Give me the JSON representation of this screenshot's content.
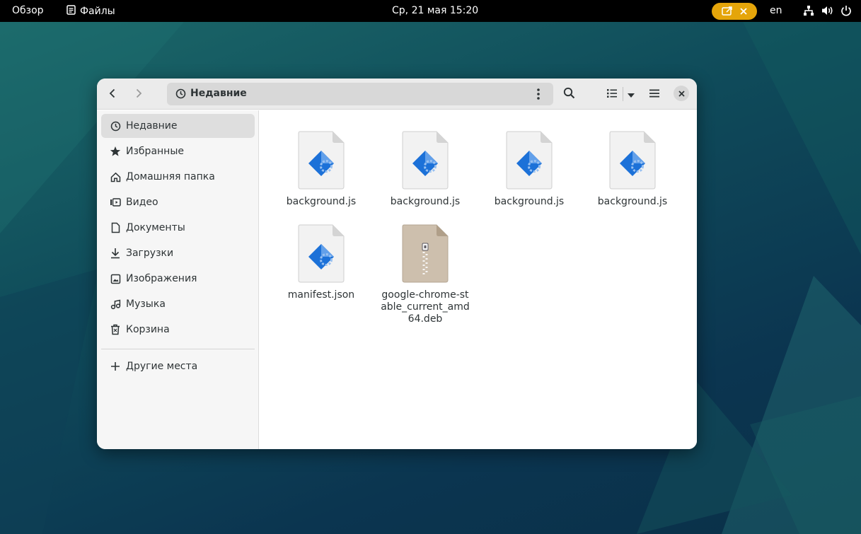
{
  "topbar": {
    "activities": "Обзор",
    "app_name": "Файлы",
    "clock": "Ср, 21 мая  15:20",
    "language": "en",
    "icons": [
      "files-app-icon",
      "screencast-icon",
      "stop-icon",
      "network-icon",
      "volume-icon",
      "power-icon"
    ],
    "screencast_color": "#e5a50a"
  },
  "window": {
    "location": "Недавние",
    "icons": [
      "back-icon",
      "forward-icon",
      "recent-icon",
      "path-menu-icon",
      "search-icon",
      "list-view-icon",
      "view-options-icon",
      "main-menu-icon",
      "close-icon"
    ]
  },
  "sidebar": {
    "items": [
      {
        "label": "Недавние",
        "icon": "recent-icon",
        "active": true
      },
      {
        "label": "Избранные",
        "icon": "star-icon"
      },
      {
        "label": "Домашняя папка",
        "icon": "home-icon"
      },
      {
        "label": "Видео",
        "icon": "video-icon"
      },
      {
        "label": "Документы",
        "icon": "document-icon"
      },
      {
        "label": "Загрузки",
        "icon": "download-icon"
      },
      {
        "label": "Изображения",
        "icon": "image-icon"
      },
      {
        "label": "Музыка",
        "icon": "music-icon"
      },
      {
        "label": "Корзина",
        "icon": "trash-icon"
      }
    ],
    "other_places": "Другие места"
  },
  "files": [
    {
      "name": "background.js",
      "type": "script"
    },
    {
      "name": "background.js",
      "type": "script"
    },
    {
      "name": "background.js",
      "type": "script"
    },
    {
      "name": "background.js",
      "type": "script"
    },
    {
      "name": "manifest.json",
      "type": "script"
    },
    {
      "name": "google-chrome-stable_current_amd64.deb",
      "type": "archive"
    }
  ],
  "colors": {
    "script_icon_blue": "#3584e4",
    "archive_tan": "#cdbfad"
  }
}
